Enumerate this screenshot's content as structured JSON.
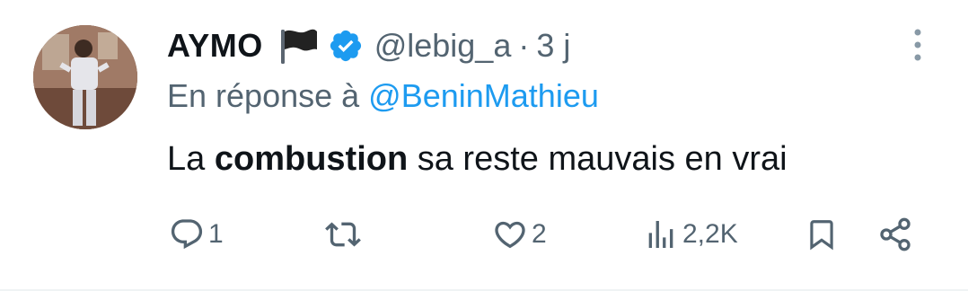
{
  "user": {
    "display_name": "AYMO",
    "flag_emoji": "black-flag",
    "verified": true,
    "handle": "@lebig_a",
    "separator": "·",
    "timestamp": "3 j"
  },
  "reply": {
    "prefix": "En réponse à",
    "mention": "@BeninMathieu"
  },
  "content": {
    "before": "La",
    "bold": "combustion",
    "after": "sa reste mauvais en vrai"
  },
  "actions": {
    "replies": "1",
    "retweets": "",
    "likes": "2",
    "views": "2,2K"
  },
  "colors": {
    "text": "#0f1419",
    "secondary": "#536471",
    "accent": "#1d9bf0"
  }
}
